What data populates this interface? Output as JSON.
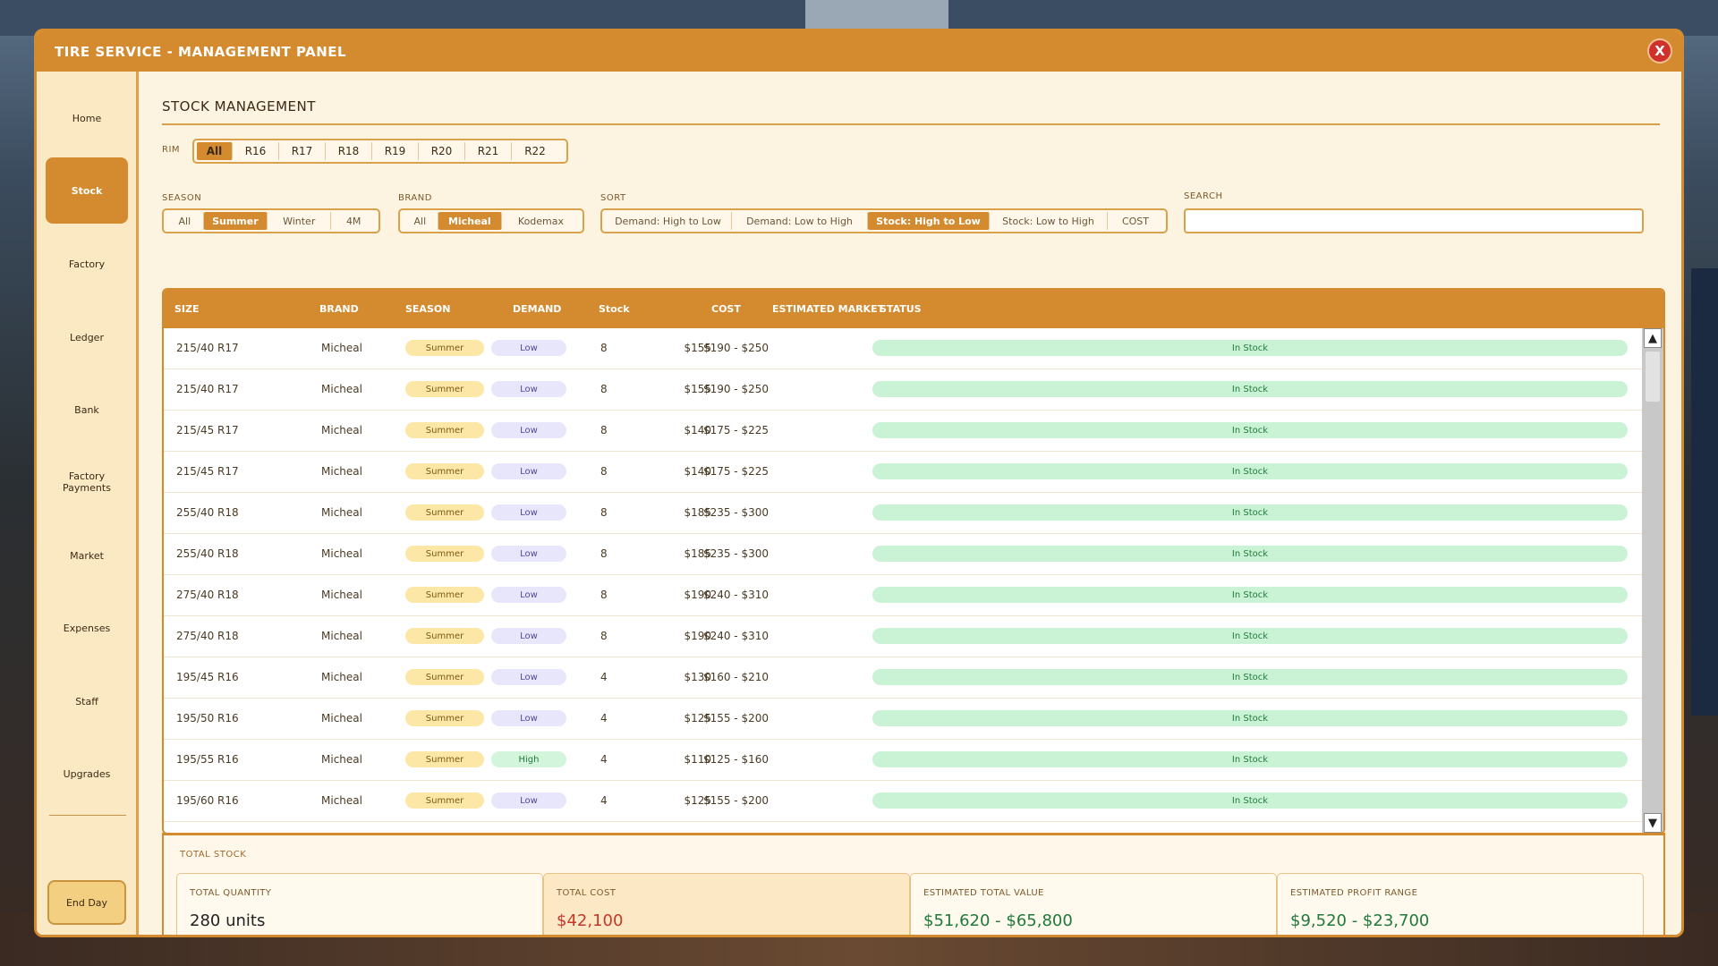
{
  "window": {
    "title": "TIRE SERVICE - MANAGEMENT PANEL",
    "close_label": "X"
  },
  "sidebar": {
    "items": [
      {
        "label": "Home",
        "active": false
      },
      {
        "label": "Stock",
        "active": true
      },
      {
        "label": "Factory",
        "active": false
      },
      {
        "label": "Ledger",
        "active": false
      },
      {
        "label": "Bank",
        "active": false
      },
      {
        "label": "Factory Payments",
        "active": false
      },
      {
        "label": "Market",
        "active": false
      },
      {
        "label": "Expenses",
        "active": false
      },
      {
        "label": "Staff",
        "active": false
      },
      {
        "label": "Upgrades",
        "active": false
      }
    ],
    "end_day": "End Day"
  },
  "page": {
    "title": "STOCK MANAGEMENT"
  },
  "filters": {
    "rim": {
      "label": "RIM",
      "options": [
        "All",
        "R16",
        "R17",
        "R18",
        "R19",
        "R20",
        "R21",
        "R22"
      ],
      "selected": "All"
    },
    "season": {
      "label": "SEASON",
      "options": [
        "All",
        "Summer",
        "Winter",
        "4M"
      ],
      "selected": "Summer"
    },
    "brand": {
      "label": "BRAND",
      "options": [
        "All",
        "Micheal",
        "Kodemax"
      ],
      "selected": "Micheal"
    },
    "sort": {
      "label": "SORT",
      "options": [
        "Demand: High to Low",
        "Demand: Low to High",
        "Stock: High to Low",
        "Stock: Low to High",
        "COST"
      ],
      "selected": "Stock: High to Low"
    },
    "search": {
      "label": "SEARCH",
      "value": "",
      "placeholder": ""
    }
  },
  "table": {
    "headers": [
      "SIZE",
      "BRAND",
      "SEASON",
      "DEMAND",
      "Stock",
      "COST",
      "ESTIMATED MARKET",
      "STATUS"
    ],
    "rows": [
      {
        "size": "215/40 R17",
        "brand": "Micheal",
        "season": "Summer",
        "demand": "Low",
        "stock": "8",
        "cost": "$155",
        "market": "$190 - $250",
        "status": "In Stock"
      },
      {
        "size": "215/40 R17",
        "brand": "Micheal",
        "season": "Summer",
        "demand": "Low",
        "stock": "8",
        "cost": "$155",
        "market": "$190 - $250",
        "status": "In Stock"
      },
      {
        "size": "215/45 R17",
        "brand": "Micheal",
        "season": "Summer",
        "demand": "Low",
        "stock": "8",
        "cost": "$140",
        "market": "$175 - $225",
        "status": "In Stock"
      },
      {
        "size": "215/45 R17",
        "brand": "Micheal",
        "season": "Summer",
        "demand": "Low",
        "stock": "8",
        "cost": "$140",
        "market": "$175 - $225",
        "status": "In Stock"
      },
      {
        "size": "255/40 R18",
        "brand": "Micheal",
        "season": "Summer",
        "demand": "Low",
        "stock": "8",
        "cost": "$185",
        "market": "$235 - $300",
        "status": "In Stock"
      },
      {
        "size": "255/40 R18",
        "brand": "Micheal",
        "season": "Summer",
        "demand": "Low",
        "stock": "8",
        "cost": "$185",
        "market": "$235 - $300",
        "status": "In Stock"
      },
      {
        "size": "275/40 R18",
        "brand": "Micheal",
        "season": "Summer",
        "demand": "Low",
        "stock": "8",
        "cost": "$190",
        "market": "$240 - $310",
        "status": "In Stock"
      },
      {
        "size": "275/40 R18",
        "brand": "Micheal",
        "season": "Summer",
        "demand": "Low",
        "stock": "8",
        "cost": "$190",
        "market": "$240 - $310",
        "status": "In Stock"
      },
      {
        "size": "195/45 R16",
        "brand": "Micheal",
        "season": "Summer",
        "demand": "Low",
        "stock": "4",
        "cost": "$130",
        "market": "$160 - $210",
        "status": "In Stock"
      },
      {
        "size": "195/50 R16",
        "brand": "Micheal",
        "season": "Summer",
        "demand": "Low",
        "stock": "4",
        "cost": "$125",
        "market": "$155 - $200",
        "status": "In Stock"
      },
      {
        "size": "195/55 R16",
        "brand": "Micheal",
        "season": "Summer",
        "demand": "High",
        "stock": "4",
        "cost": "$110",
        "market": "$125 - $160",
        "status": "In Stock"
      },
      {
        "size": "195/60 R16",
        "brand": "Micheal",
        "season": "Summer",
        "demand": "Low",
        "stock": "4",
        "cost": "$125",
        "market": "$155 - $200",
        "status": "In Stock"
      }
    ]
  },
  "totals": {
    "title": "TOTAL STOCK",
    "cards": [
      {
        "label": "TOTAL QUANTITY",
        "value": "280 units",
        "color": "#222222"
      },
      {
        "label": "TOTAL COST",
        "value": "$42,100",
        "color": "#c0392b"
      },
      {
        "label": "ESTIMATED TOTAL VALUE",
        "value": "$51,620 - $65,800",
        "color": "#1e7a3a"
      },
      {
        "label": "ESTIMATED PROFIT RANGE",
        "value": "$9,520 - $23,700",
        "color": "#1e7a3a"
      }
    ]
  },
  "colors": {
    "accent": "#d48b2f",
    "panel_bg": "#fdf3e1",
    "close": "#d0322b"
  },
  "icons": {
    "scroll_up": "▲",
    "scroll_down": "▼"
  }
}
